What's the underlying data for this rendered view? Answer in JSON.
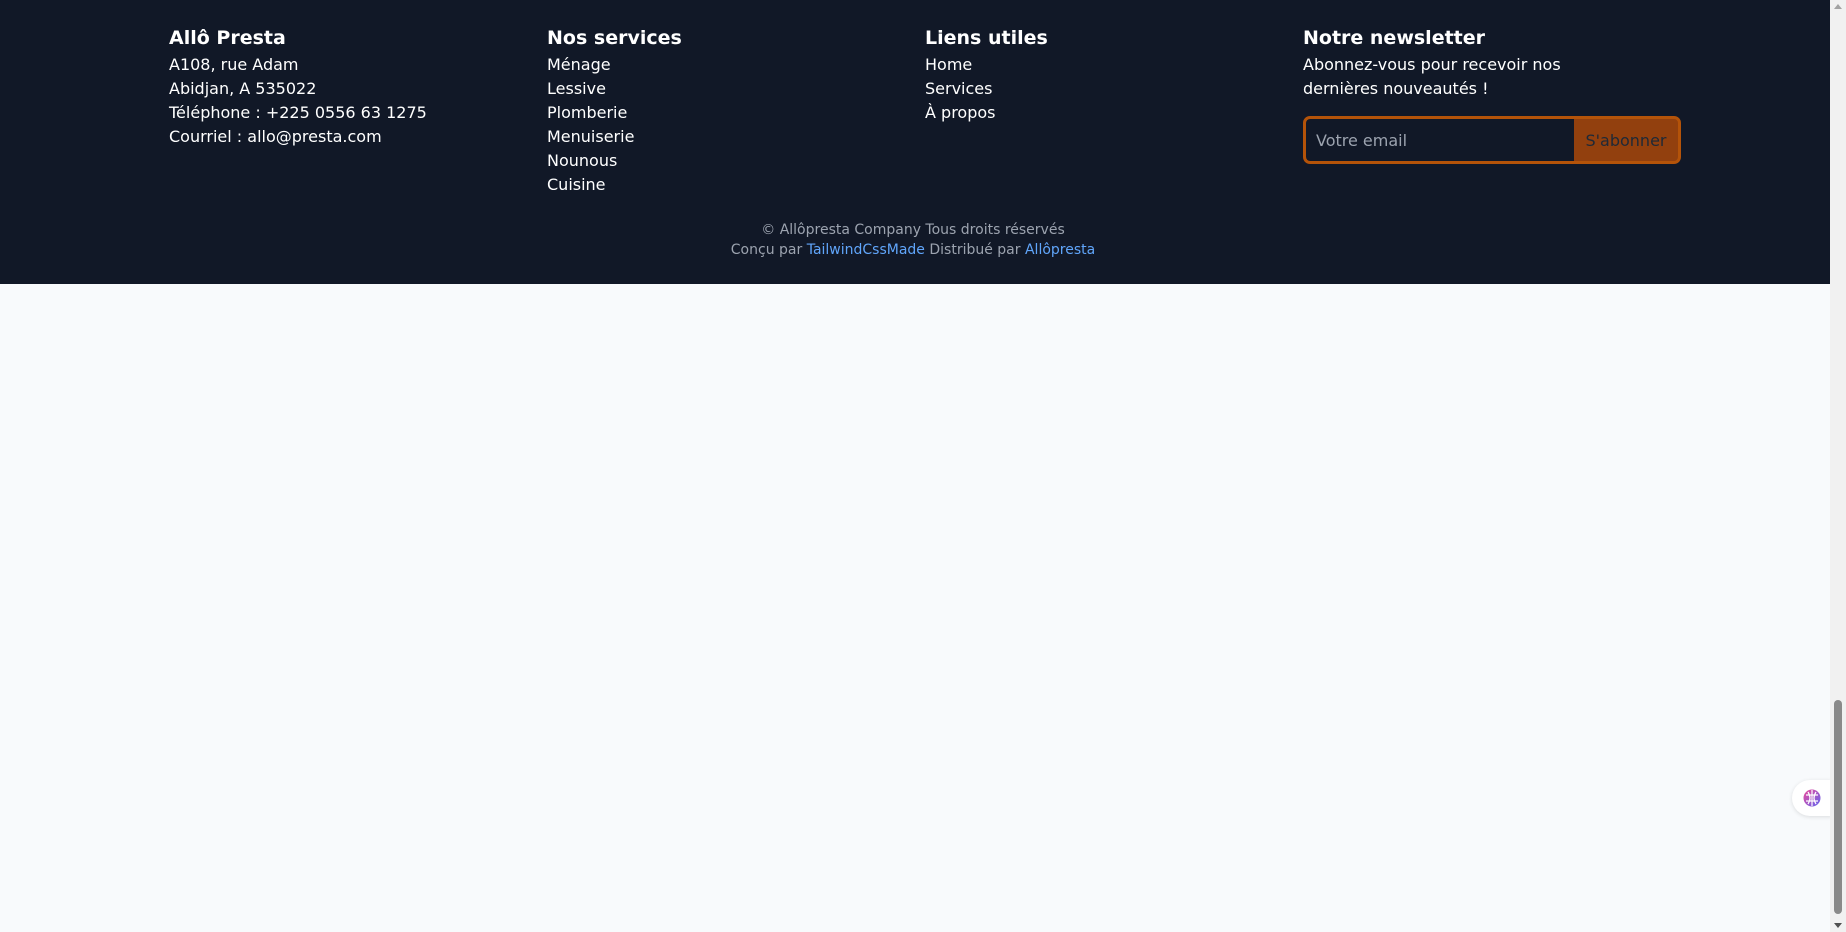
{
  "footer": {
    "company": {
      "title": "Allô Presta",
      "address_line1": "A108, rue Adam",
      "address_line2": "Abidjan, A 535022",
      "phone": "Téléphone : +225 0556 63 1275",
      "email": "Courriel : allo@presta.com"
    },
    "services": {
      "title": "Nos services",
      "items": [
        "Ménage",
        "Lessive",
        "Plomberie",
        "Menuiserie",
        "Nounous",
        "Cuisine"
      ]
    },
    "links": {
      "title": "Liens utiles",
      "items": [
        "Home",
        "Services",
        "À propos"
      ]
    },
    "newsletter": {
      "title": "Notre newsletter",
      "text": "Abonnez-vous pour recevoir nos dernières nouveautés !",
      "placeholder": "Votre email",
      "button": "S'abonner"
    },
    "bottom": {
      "copyright": "© Allôpresta Company Tous droits réservés",
      "designed_prefix": "Conçu par",
      "designed_link": "TailwindCssMade",
      "distributed_prefix": "Distribué par",
      "distributed_link": "Allôpresta"
    }
  },
  "colors": {
    "footer_bg": "#111827",
    "page_bg": "#f8fafc",
    "accent": "#92400e",
    "link": "#60a5fa"
  },
  "icons": {
    "floating_widget": "brain-icon"
  }
}
